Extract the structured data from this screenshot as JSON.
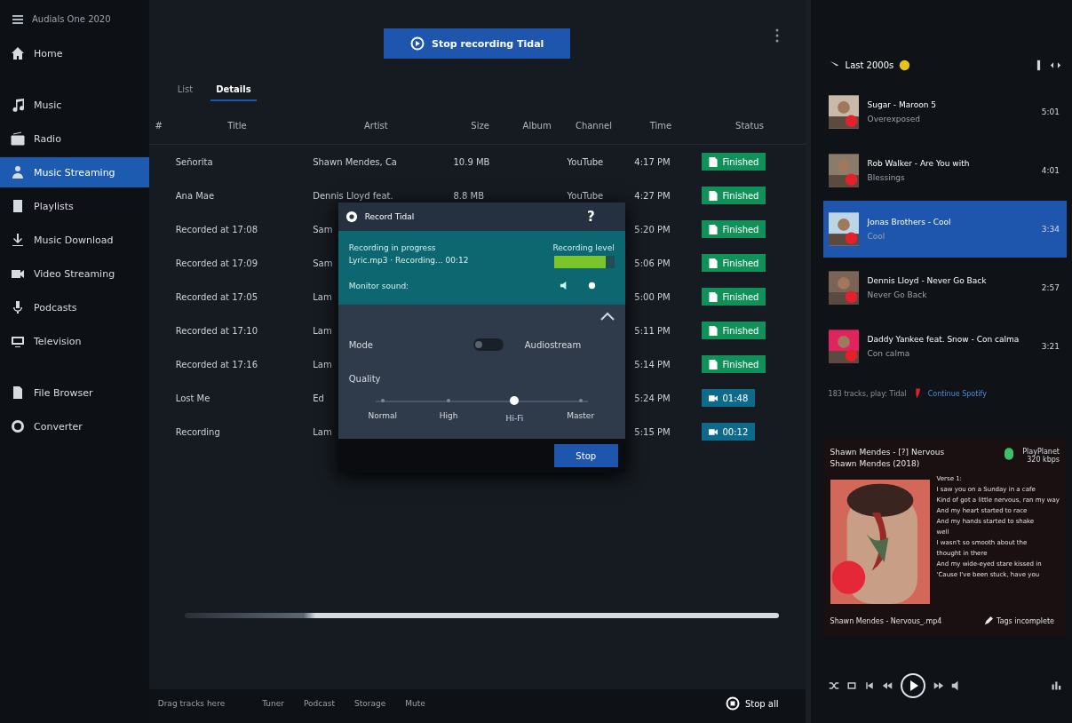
{
  "app_title": "Audials One 2020",
  "sidebar": {
    "items": [
      {
        "label": "Home",
        "selected": false
      },
      {
        "label": "Music",
        "selected": false
      },
      {
        "label": "Radio",
        "selected": false
      },
      {
        "label": "Music Streaming",
        "selected": true
      },
      {
        "label": "Playlists",
        "selected": false
      },
      {
        "label": "Music Download",
        "selected": false
      },
      {
        "label": "Video Streaming",
        "selected": false
      },
      {
        "label": "Podcasts",
        "selected": false
      },
      {
        "label": "Television",
        "selected": false
      },
      {
        "label": "File Browser",
        "selected": false
      },
      {
        "label": "Converter",
        "selected": false
      }
    ]
  },
  "record_button": "Stop recording Tidal",
  "tabs": [
    {
      "label": "List",
      "selected": false
    },
    {
      "label": "Details",
      "selected": true
    }
  ],
  "table": {
    "columns": [
      "#",
      "Title",
      "Artist",
      "Size",
      "Album",
      "Channel",
      "Time",
      "Status"
    ],
    "rows": [
      {
        "title": "Señorita",
        "artist": "Shawn Mendes, Ca",
        "size": "10.9 MB",
        "channel": "YouTube",
        "time": "4:17 PM",
        "status": {
          "kind": "finished",
          "text": "Finished"
        }
      },
      {
        "title": "Ana Mae",
        "artist": "Dennis Lloyd feat.",
        "size": "8.8 MB",
        "channel": "YouTube",
        "time": "4:27 PM",
        "status": {
          "kind": "finished",
          "text": "Finished"
        }
      },
      {
        "title": "Recorded at 17:08",
        "artist": "Sam",
        "size": "",
        "channel": "",
        "time": "5:20 PM",
        "status": {
          "kind": "finished",
          "text": "Finished"
        }
      },
      {
        "title": "Recorded at 17:09",
        "artist": "Sam",
        "size": "",
        "channel": "",
        "time": "5:06 PM",
        "status": {
          "kind": "finished",
          "text": "Finished"
        }
      },
      {
        "title": "Recorded at 17:05",
        "artist": "Lam",
        "size": "",
        "channel": "",
        "time": "5:00 PM",
        "status": {
          "kind": "finished",
          "text": "Finished"
        }
      },
      {
        "title": "Recorded at 17:10",
        "artist": "Lam",
        "size": "",
        "channel": "",
        "time": "5:11 PM",
        "status": {
          "kind": "finished",
          "text": "Finished"
        }
      },
      {
        "title": "Recorded at 17:16",
        "artist": "Lam",
        "size": "",
        "channel": "",
        "time": "5:14 PM",
        "status": {
          "kind": "finished",
          "text": "Finished"
        }
      },
      {
        "title": "Lost Me",
        "artist": "Ed",
        "size": "",
        "channel": "",
        "time": "5:24 PM",
        "status": {
          "kind": "recording",
          "text": "01:48"
        }
      },
      {
        "title": "Recording",
        "artist": "Lam",
        "size": "",
        "channel": "",
        "time": "5:15 PM",
        "status": {
          "kind": "recording",
          "text": "00:12"
        }
      }
    ]
  },
  "dialog": {
    "title": "Record Tidal",
    "help": "?",
    "status_line": "Recording in progress",
    "file_line": "Lyric.mp3 · Recording... 00:12",
    "level_label": "Recording level",
    "level": 0.85,
    "monitor_label": "Monitor sound:",
    "mode_label": "Mode",
    "mode_on": false,
    "mode_value": "Audiostream",
    "quality_label": "Quality",
    "quality_options": [
      {
        "label": "Normal",
        "selected": false
      },
      {
        "label": "High",
        "selected": false
      },
      {
        "label": "Hi-Fi",
        "selected": true
      },
      {
        "label": "Master",
        "selected": false
      }
    ],
    "stop_button": "Stop"
  },
  "playlist": {
    "title": "Last 2000s",
    "items": [
      {
        "title": "Sugar - Maroon 5",
        "subtitle": "Overexposed",
        "duration": "5:01",
        "selected": false
      },
      {
        "title": "Rob Walker - Are You with",
        "subtitle": "Blessings",
        "duration": "4:01",
        "selected": false
      },
      {
        "title": "Jonas Brothers - Cool",
        "subtitle": "Cool",
        "duration": "3:34",
        "selected": true
      },
      {
        "title": "Dennis Lloyd - Never Go Back",
        "subtitle": "Never Go Back",
        "duration": "2:57",
        "selected": false
      },
      {
        "title": "Daddy Yankee feat. Snow - Con calma",
        "subtitle": "Con calma",
        "duration": "3:21",
        "selected": false
      }
    ],
    "footer_text": "183 tracks, play: Tidal",
    "footer_link": "Continue Spotify"
  },
  "now_playing": {
    "title": "Shawn Mendes - [?] Nervous",
    "subtitle": "Shawn Mendes (2018)",
    "source": "PlayPlanet 320 kbps",
    "lyrics": [
      "Verse 1:",
      "I saw you on a Sunday in a cafe",
      "Kind of got a little nervous, ran my way",
      "And my heart started to race",
      "And my hands started to shake",
      "well",
      "I wasn't so smooth about the",
      "thought in there",
      "And my wide-eyed stare kissed in",
      "'Cause I've been stuck, have you"
    ],
    "filename": "Shawn Mendes - Nervous_.mp4",
    "tag_button": "Tags incomplete"
  },
  "status_bar": {
    "drop_text": "Drag tracks here",
    "items": [
      "Tuner",
      "Podcast",
      "Storage",
      "Mute"
    ],
    "stop_all": "Stop all"
  }
}
